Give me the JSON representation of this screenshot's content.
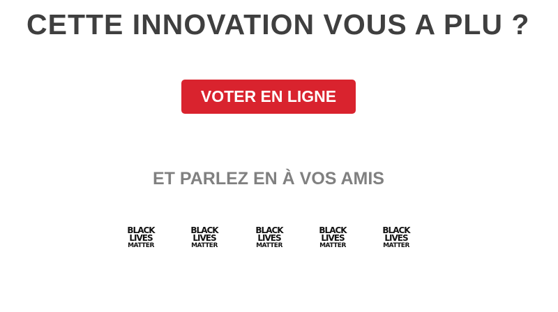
{
  "title": "CETTE INNOVATION VOUS A PLU ?",
  "vote_button": {
    "label": "VOTER EN LIGNE"
  },
  "share": {
    "heading": "ET PARLEZ EN À VOS AMIS",
    "items": [
      {
        "icon": "black-lives-matter-icon",
        "line1": "BLACK",
        "line2": "LIVES",
        "line3": "MATTER"
      },
      {
        "icon": "black-lives-matter-icon",
        "line1": "BLACK",
        "line2": "LIVES",
        "line3": "MATTER"
      },
      {
        "icon": "black-lives-matter-icon",
        "line1": "BLACK",
        "line2": "LIVES",
        "line3": "MATTER"
      },
      {
        "icon": "black-lives-matter-icon",
        "line1": "BLACK",
        "line2": "LIVES",
        "line3": "MATTER"
      },
      {
        "icon": "black-lives-matter-icon",
        "line1": "BLACK",
        "line2": "LIVES",
        "line3": "MATTER"
      }
    ]
  },
  "colors": {
    "title": "#3f3f3f",
    "button_bg": "#d9232e",
    "button_text": "#ffffff",
    "heading": "#808080"
  }
}
